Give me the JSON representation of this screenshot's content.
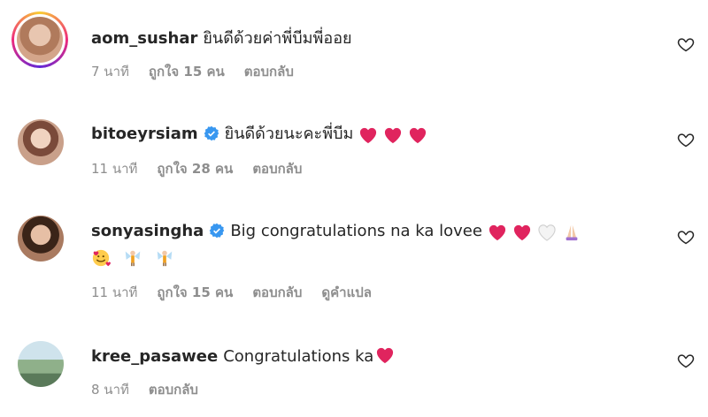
{
  "comments": [
    {
      "username": "aom_sushar",
      "text": "ยินดีด้วยค่าพี่บีมพี่ออย",
      "time": "7 นาที",
      "likes": "ถูกใจ 15 คน",
      "reply": "ตอบกลับ",
      "verified": false
    },
    {
      "username": "bitoeyrsiam",
      "text": "ยินดีด้วยนะคะพี่บีม",
      "time": "11 นาที",
      "likes": "ถูกใจ 28 คน",
      "reply": "ตอบกลับ",
      "verified": true
    },
    {
      "username": "sonyasingha",
      "text": "Big congratulations na ka lovee",
      "time": "11 นาที",
      "likes": "ถูกใจ 15 คน",
      "reply": "ตอบกลับ",
      "translate": "ดูคำแปล",
      "verified": true
    },
    {
      "username": "kree_pasawee",
      "text": "Congratulations ka",
      "time": "8 นาที",
      "reply": "ตอบกลับ",
      "verified": false
    }
  ],
  "icons": {
    "like": "heart-outline-icon",
    "verified": "verified-badge-icon",
    "heart_emoji": "red-heart-emoji"
  },
  "colors": {
    "text": "#262626",
    "meta": "#8e8e8e",
    "verified": "#3897f0",
    "heart": "#e0245e"
  }
}
